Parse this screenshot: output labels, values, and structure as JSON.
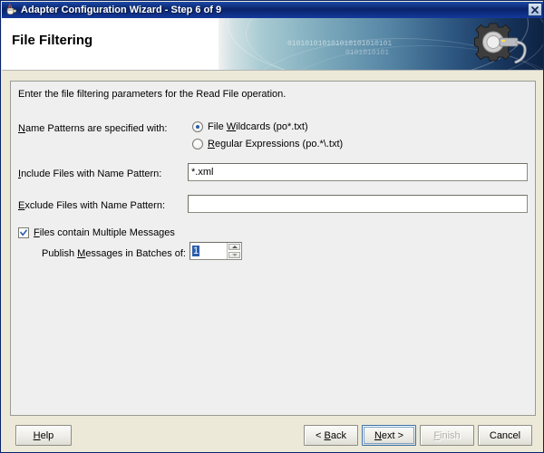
{
  "window": {
    "title": "Adapter Configuration Wizard - Step 6 of 9",
    "icon": "java-coffee-cup-icon",
    "close_label": "✕"
  },
  "banner": {
    "heading": "File Filtering",
    "binary_text": "010101010101010101010101",
    "binary_text_2": "0101010101",
    "art_icon": "gear-with-plug-icon",
    "gradient_from": "#a9cbd3",
    "gradient_to": "#0d2242"
  },
  "content": {
    "intro": "Enter the file filtering parameters for the Read File operation.",
    "name_patterns": {
      "label_pre": "N",
      "label": "Name Patterns are specified with:",
      "options": [
        {
          "pre": "File ",
          "mn": "W",
          "post": "ildcards (po*.txt)",
          "selected": true
        },
        {
          "pre": "",
          "mn": "R",
          "post": "egular Expressions (po.*\\.txt)",
          "selected": false
        }
      ]
    },
    "include": {
      "mn": "I",
      "label_rest": "nclude Files with Name Pattern:",
      "value": "*.xml",
      "placeholder": ""
    },
    "exclude": {
      "mn": "E",
      "label_rest": "xclude Files with Name Pattern:",
      "value": "",
      "placeholder": ""
    },
    "multiple_messages": {
      "mn": "F",
      "label_rest": "iles contain Multiple Messages",
      "checked": true
    },
    "batch": {
      "label_pre": "Publish ",
      "mn": "M",
      "label_post": "essages in Batches of:",
      "value": "1",
      "value_selected": true
    }
  },
  "buttons": {
    "help": {
      "mn": "H",
      "rest": "elp",
      "disabled": false,
      "focused": false
    },
    "back": {
      "pre": "< ",
      "mn": "B",
      "rest": "ack",
      "disabled": false,
      "focused": false
    },
    "next": {
      "pre": "",
      "mn": "N",
      "rest": "ext >",
      "disabled": false,
      "focused": true
    },
    "finish": {
      "pre": "",
      "mn": "F",
      "rest": "inish",
      "disabled": true,
      "focused": false
    },
    "cancel": {
      "pre": "",
      "mn": "",
      "rest": "Cancel",
      "disabled": false,
      "focused": false
    }
  },
  "colors": {
    "titlebar": "#0a246a",
    "accent": "#2a5dab",
    "panel": "#efefef",
    "dialog": "#ece9d8"
  }
}
